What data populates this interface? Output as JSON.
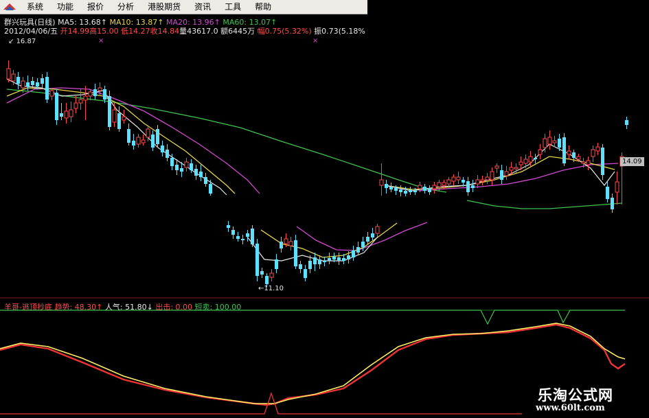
{
  "menu": {
    "items": [
      "系统",
      "功能",
      "报价",
      "分析",
      "港股期货",
      "资讯",
      "工具",
      "帮助"
    ]
  },
  "stock": {
    "name": "群兴玩具(日线)",
    "ma5": "MA5: 13.68↑",
    "ma10": "MA10: 13.87↑",
    "ma20": "MA20: 13.96↑",
    "ma60": "MA60: 13.07↑"
  },
  "quote": {
    "date": "2012/04/06/五",
    "open": "开14.99",
    "high": "高15.00",
    "low": "低14.27",
    "close": "收14.84",
    "volume": "量43617.0",
    "amount": "额6445万",
    "change": "幅0.75(5.32%)",
    "amplitude": "振0.73(5.18%"
  },
  "chart": {
    "high_label": "16.87",
    "low_label": "11.10",
    "last_price": "14.09"
  },
  "indicator": {
    "name": "羊哥-逃顶抄底",
    "trend": "趋势: 48.30↑",
    "popularity": "人气: 51.80↓",
    "exit": "出击: 0.00",
    "sell": "短卖: 100.00"
  },
  "watermark": {
    "title": "乐淘公式网",
    "url": "www.60lt.com"
  },
  "colors": {
    "up": "#ff4b4b",
    "down": "#5ee0ff",
    "ma5": "#e8e8e8",
    "ma10": "#e8d64a",
    "ma20": "#d24ad2",
    "ma60": "#3fc44f"
  }
}
